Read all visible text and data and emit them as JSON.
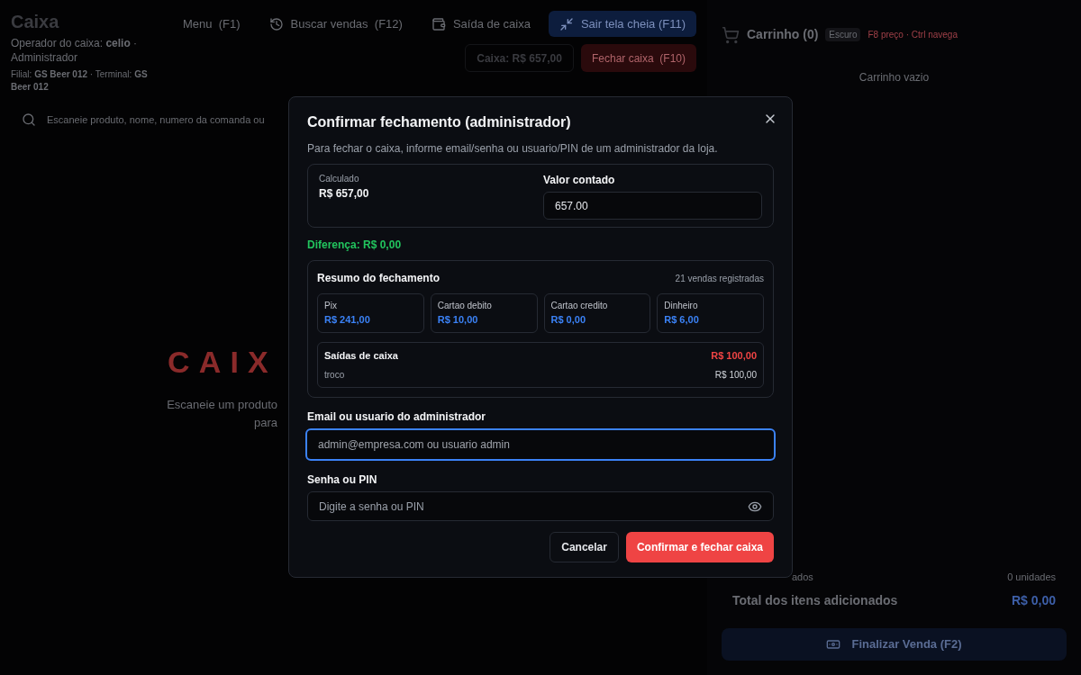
{
  "header": {
    "title": "Caixa",
    "operator_line": "Operador do caixa: **celio** · Administrador",
    "branch_line": "Filial: **GS Beer 012** · Terminal: **GS Beer 012**"
  },
  "toolbar": [
    {
      "label": "Menu  (F1)",
      "kind": "plain"
    },
    {
      "label": "Buscar vendas  (F12)",
      "kind": "history"
    },
    {
      "label": "Saída de caixa",
      "kind": "wallet"
    },
    {
      "label": "Sair tela cheia (F11)",
      "kind": "primary"
    }
  ],
  "cash_badge": "Caixa: R$ 657,00",
  "close_button": "Fechar caixa  (F10)",
  "search": {
    "placeholder": "Escaneie produto, nome, numero da comanda ou"
  },
  "empty_state": {
    "title": "CAIX",
    "line1": "Escaneie um produto",
    "line2": "para"
  },
  "cart": {
    "title": "Carrinho (0)",
    "theme": "Escuro",
    "hint": "F8 preço · Ctrl navega",
    "empty": "Carrinho vazio",
    "items_label": "ados",
    "units": "0 unidades",
    "total_label": "Total dos itens adicionados",
    "total": "R$ 0,00",
    "finish_button": "Finalizar Venda (F2)",
    "finish_disabled": true
  },
  "dialog": {
    "title": "Confirmar fechamento (administrador)",
    "description": "Para fechar o caixa, informe email/senha ou usuario/PIN de um administrador da loja.",
    "calculated_label": "Calculado",
    "calculated": "R$ 657,00",
    "counted_label": "Valor contado",
    "counted": "657.00",
    "difference": "Diferença: R$ 0,00",
    "summary": {
      "title": "Resumo do fechamento",
      "count": "21 vendas registradas",
      "methods": [
        {
          "name": "Pix",
          "value": "R$ 241,00"
        },
        {
          "name": "Cartao debito",
          "value": "R$ 10,00"
        },
        {
          "name": "Cartao credito",
          "value": "R$ 0,00"
        },
        {
          "name": "Dinheiro",
          "value": "R$ 6,00"
        }
      ],
      "withdrawals": {
        "title": "Saídas de caixa",
        "total": "R$ 100,00",
        "items": [
          {
            "name": "troco",
            "value": "R$ 100,00"
          }
        ]
      }
    },
    "email": {
      "label": "Email ou usuario do administrador",
      "placeholder": "admin@empresa.com ou usuario admin",
      "focused": true
    },
    "password": {
      "label": "Senha ou PIN",
      "placeholder": "Digite a senha ou PIN"
    },
    "buttons": [
      {
        "label": "Cancelar",
        "kind": "secondary"
      },
      {
        "label": "Confirmar e fechar caixa",
        "kind": "danger"
      }
    ]
  }
}
